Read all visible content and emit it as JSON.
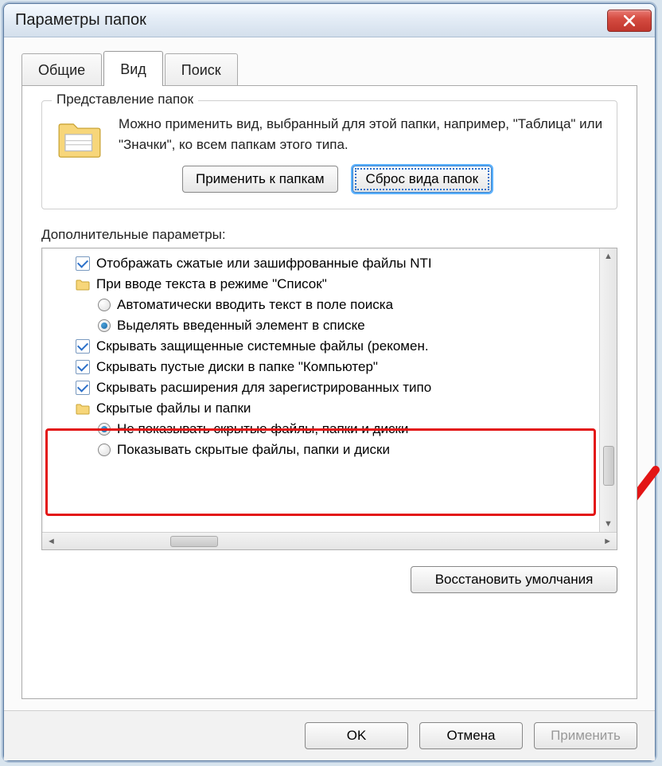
{
  "window": {
    "title": "Параметры папок"
  },
  "tabs": {
    "general": "Общие",
    "view": "Вид",
    "search": "Поиск"
  },
  "group": {
    "title": "Представление папок",
    "desc": "Можно применить вид, выбранный для этой папки, например, \"Таблица\" или \"Значки\", ко всем папкам этого типа.",
    "apply": "Применить к папкам",
    "reset": "Сброс вида папок"
  },
  "advanced": {
    "label": "Дополнительные параметры:",
    "items": {
      "ntfs": "Отображать сжатые или зашифрованные файлы NTI",
      "typing": "При вводе текста в режиме \"Список\"",
      "typing_auto": "Автоматически вводить текст в поле поиска",
      "typing_select": "Выделять введенный элемент в списке",
      "hide_sys": "Скрывать защищенные системные файлы (рекомен.",
      "hide_empty": "Скрывать пустые диски в папке \"Компьютер\"",
      "hide_ext": "Скрывать расширения для зарегистрированных типо",
      "hidden": "Скрытые файлы и папки",
      "hidden_no": "Не показывать скрытые файлы, папки и диски",
      "hidden_yes": "Показывать скрытые файлы, папки и диски"
    }
  },
  "restore": "Восстановить умолчания",
  "buttons": {
    "ok": "OK",
    "cancel": "Отмена",
    "apply": "Применить"
  }
}
